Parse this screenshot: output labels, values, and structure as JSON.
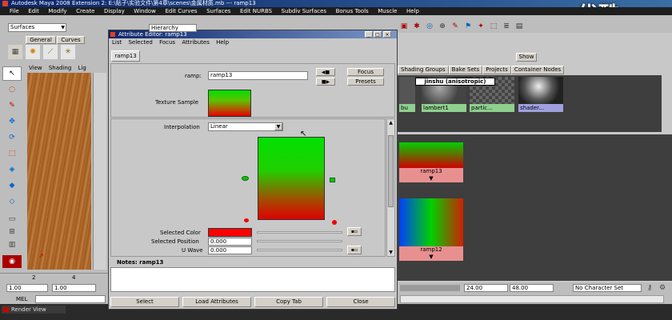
{
  "window": {
    "title": "Autodesk Maya 2008 Extension 2: E:\\贴子\\实验文件\\第4章\\scenes\\金属材质.mb --- ramp13",
    "menu": [
      "File",
      "Edit",
      "Modify",
      "Create",
      "Display",
      "Window",
      "Edit Curves",
      "Surfaces",
      "Edit NURBS",
      "Subdiv Surfaces",
      "Bonus Tools",
      "Muscle",
      "Help"
    ],
    "watermark": "优酷"
  },
  "left": {
    "mode_select": "Surfaces",
    "tabs": [
      "General",
      "Curves"
    ],
    "viewport_menu": [
      "View",
      "Shading",
      "Lig"
    ],
    "time_values": [
      "1.00",
      "1.00"
    ],
    "frame_marks": [
      "2",
      "4"
    ],
    "mel_label": "MEL",
    "render_view": "Render View"
  },
  "attribute_editor": {
    "title": "Attribute Editor: ramp13",
    "menu": [
      "List",
      "Selected",
      "Focus",
      "Attributes",
      "Help"
    ],
    "tab": "ramp13",
    "ramp_label": "ramp:",
    "ramp_value": "ramp13",
    "focus_button": "Focus",
    "presets_button": "Presets",
    "texture_sample_label": "Texture Sample",
    "interpolation_label": "Interpolation",
    "interpolation_value": "Linear",
    "selected_color_label": "Selected Color",
    "selected_position_label": "Selected Position",
    "selected_position_value": "0.000",
    "u_wave_label": "U Wave",
    "u_wave_value": "0.000",
    "notes_label": "Notes:",
    "notes_value": "ramp13",
    "buttons": [
      "Select",
      "Load Attributes",
      "Copy Tab",
      "Close"
    ],
    "colors": {
      "ramp_top": "#00e000",
      "ramp_bottom": "#e00000",
      "selected": "#ff0000"
    }
  },
  "hypershade": {
    "field_label": "Hierarchy",
    "show_button": "Show",
    "tabs": [
      "Shading Groups",
      "Bake Sets",
      "Projects",
      "Container Nodes"
    ],
    "materials": [
      {
        "label": "bu"
      },
      {
        "label": "lambert1"
      },
      {
        "label": "partic..."
      },
      {
        "label": "shader..."
      }
    ],
    "tooltip": "jinshu (anisotropic)",
    "nodes": [
      {
        "label": "ramp13"
      },
      {
        "label": "ramp12"
      }
    ],
    "range_start": "24.00",
    "range_end": "48.00",
    "character_set": "No Character Set"
  }
}
